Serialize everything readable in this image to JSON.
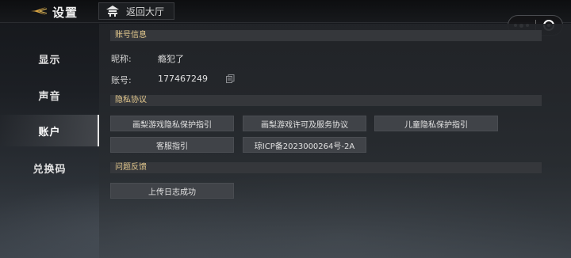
{
  "header": {
    "title": "设置",
    "home_label": "返回大厅"
  },
  "sidebar": {
    "items": [
      {
        "label": "显示",
        "active": false
      },
      {
        "label": "声音",
        "active": false
      },
      {
        "label": "账户",
        "active": true
      },
      {
        "label": "兑换码",
        "active": false
      }
    ]
  },
  "account": {
    "section_title": "账号信息",
    "nickname_label": "昵称:",
    "nickname_value": "瘾犯了",
    "account_label": "账号:",
    "account_value": "177467249"
  },
  "privacy": {
    "section_title": "隐私协议",
    "buttons": [
      "画梨游戏隐私保护指引",
      "画梨游戏许可及服务协议",
      "儿童隐私保护指引",
      "客服指引",
      "琼ICP备2023000264号-2A"
    ]
  },
  "feedback": {
    "section_title": "问题反馈",
    "upload_label": "上传日志成功"
  },
  "colors": {
    "section_title": "#e3c88d",
    "accent_chevron": "#d9a441"
  }
}
